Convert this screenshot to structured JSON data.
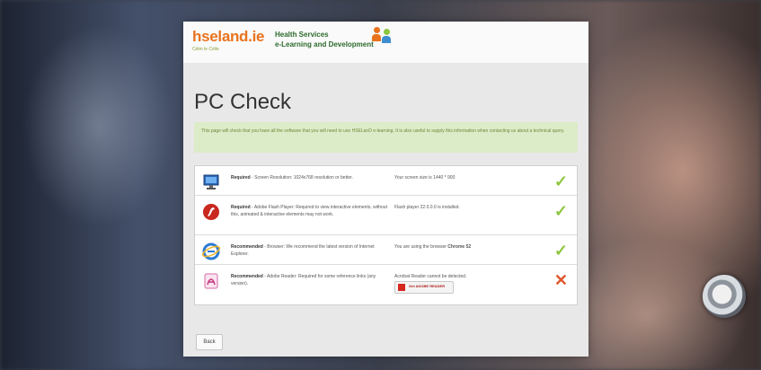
{
  "header": {
    "logo_main": "hseland",
    "logo_tld": ".ie",
    "logo_tagline": "Céim le Céile",
    "hs_line1": "Health Services",
    "hs_line2": "e-Learning and Development"
  },
  "page_title": "PC Check",
  "notice": "This page will check that you have all the software that you will need to use HSELanD e-learning. It is also useful to supply this information when contacting us about a technical query.",
  "checks": [
    {
      "icon": "monitor-icon",
      "level": "Required",
      "description": " - Screen Resolution: 1024x768 resolution or better.",
      "result": "Your screen size is 1440 * 900",
      "status": "pass"
    },
    {
      "icon": "flash-player-icon",
      "level": "Required",
      "description": " - Adobe Flash Player: Required to view interactive elements, without this, animated & interactive elements may not work.",
      "result": "Flash player 22.0.0.0 is installed.",
      "status": "pass"
    },
    {
      "icon": "browser-icon",
      "level": "Recommended",
      "description": " - Browser: We recommend the latest version of Internet Explorer.",
      "result_prefix": "You are using the browser ",
      "result_strong": "Chrome 52",
      "status": "pass"
    },
    {
      "icon": "adobe-reader-icon",
      "level": "Recommended",
      "description": " - Adobe Reader: Required for some reference links (any version).",
      "result": "Acrobat Reader cannot be detected.",
      "get_reader_label": "Get ADOBE READER",
      "status": "fail"
    }
  ],
  "status_symbols": {
    "pass": "✓",
    "fail": "✕"
  },
  "back_label": "Back",
  "colors": {
    "brand_orange": "#e8731e",
    "hs_green": "#2d6a2d",
    "notice_bg": "#dcebc8",
    "pass": "#8dc63f",
    "fail": "#e0542a"
  }
}
